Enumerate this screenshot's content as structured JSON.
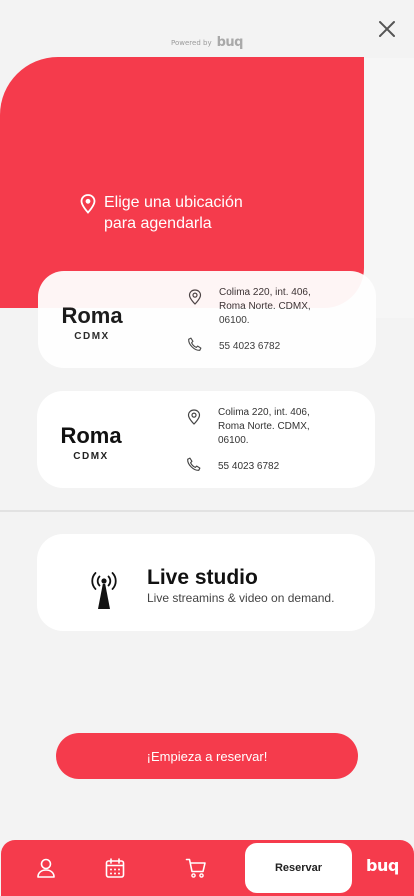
{
  "header": {
    "powered_text": "Powered by",
    "powered_logo": "buq",
    "close_icon": "close-icon"
  },
  "hero": {
    "line1": "Elige una ubicación",
    "line2": "para agendarla",
    "icon": "location-pin-icon",
    "color": "#f53b4c"
  },
  "locations": [
    {
      "name": "Roma",
      "city": "CDMX",
      "address_lines": [
        "Colima 220, int. 406,",
        "Roma Norte. CDMX,",
        "06100."
      ],
      "phone": "55 4023 6782"
    },
    {
      "name": "Roma",
      "city": "CDMX",
      "address_lines": [
        "Colima 220, int. 406,",
        "Roma Norte. CDMX,",
        "06100."
      ],
      "phone": "55 4023 6782"
    }
  ],
  "live": {
    "title": "Live studio",
    "subtitle": "Live streamins & video on demand.",
    "icon": "broadcast-tower-icon"
  },
  "cta": {
    "label": "¡Empieza a reservar!"
  },
  "navbar": {
    "items": [
      {
        "icon": "user-icon"
      },
      {
        "icon": "calendar-icon"
      },
      {
        "icon": "cart-icon"
      }
    ],
    "active_label": "Reservar",
    "logo": "buq"
  }
}
